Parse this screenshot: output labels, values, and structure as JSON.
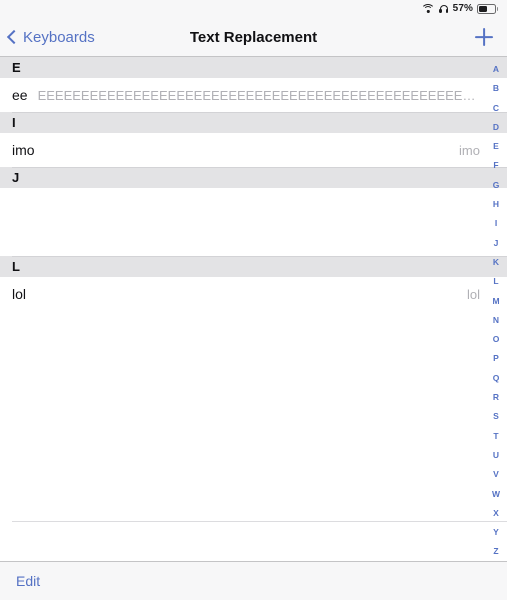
{
  "status_bar": {
    "wifi_icon": "wifi-icon",
    "headphones_icon": "headphones-icon",
    "battery_percent": "57%",
    "battery_icon": "battery-icon",
    "battery_level": 57
  },
  "nav": {
    "back_label": "Keyboards",
    "back_icon": "chevron-left-icon",
    "title": "Text Replacement",
    "add_icon": "plus-icon"
  },
  "sections": [
    {
      "letter": "E",
      "rows": [
        {
          "shortcut": "ee",
          "phrase": "EEEEEEEEEEEEEEEEEEEEEEEEEEEEEEEEEEEEEEEEEEEEEEEEEEEEEEEEEEEEEEEE...",
          "phrase_position": "inline"
        }
      ]
    },
    {
      "letter": "I",
      "rows": [
        {
          "shortcut": "imo",
          "phrase": "imo",
          "phrase_position": "trailing"
        }
      ]
    },
    {
      "letter": "J",
      "rows": [
        {
          "shortcut": "",
          "phrase": "",
          "phrase_position": "trailing"
        },
        {
          "shortcut": "",
          "phrase": "",
          "phrase_position": "trailing"
        }
      ]
    },
    {
      "letter": "L",
      "rows": [
        {
          "shortcut": "lol",
          "phrase": "lol",
          "phrase_position": "trailing"
        }
      ]
    }
  ],
  "trailing_empty_rows": 6,
  "index_bar": {
    "letters": [
      "A",
      "B",
      "C",
      "D",
      "E",
      "F",
      "G",
      "H",
      "I",
      "J",
      "K",
      "L",
      "M",
      "N",
      "O",
      "P",
      "Q",
      "R",
      "S",
      "T",
      "U",
      "V",
      "W",
      "X",
      "Y",
      "Z",
      "#"
    ]
  },
  "toolbar": {
    "edit_label": "Edit"
  },
  "colors": {
    "accent": "#5572c4",
    "section_header_bg": "#e3e3e5",
    "chrome_bg": "#f7f7f8",
    "phrase_gray": "#b0b0b5",
    "text_primary": "#111114"
  }
}
